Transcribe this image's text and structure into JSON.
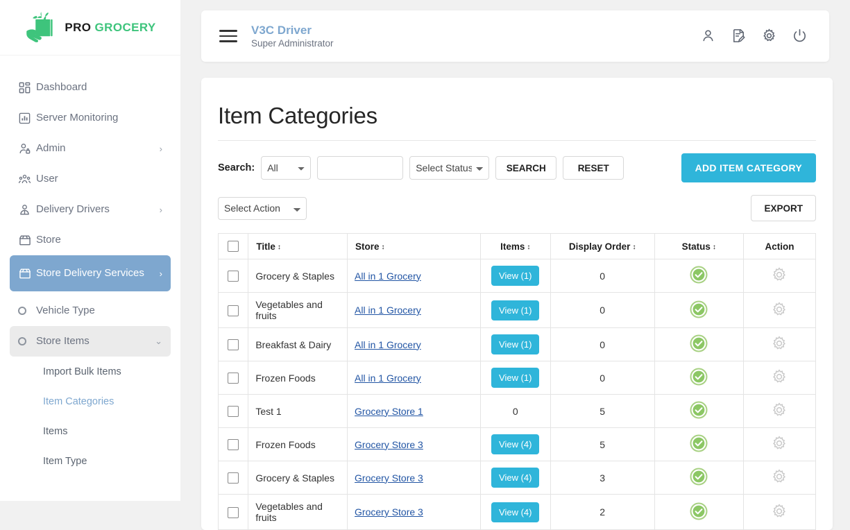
{
  "brand": {
    "pro": "PRO",
    "grocery": "GROCERY"
  },
  "sidebar": {
    "items": [
      {
        "label": "Dashboard",
        "icon": "dashboard-grid-icon",
        "chevron": ""
      },
      {
        "label": "Server Monitoring",
        "icon": "bar-chart-icon",
        "chevron": ""
      },
      {
        "label": "Admin",
        "icon": "admin-user-lock-icon",
        "chevron": "›"
      },
      {
        "label": "User",
        "icon": "users-group-icon",
        "chevron": ""
      },
      {
        "label": "Delivery Drivers",
        "icon": "driver-person-icon",
        "chevron": "›"
      },
      {
        "label": "Store",
        "icon": "store-icon",
        "chevron": ""
      },
      {
        "label": "Store Delivery Services",
        "icon": "store-icon",
        "chevron": "›"
      },
      {
        "label": "Vehicle Type",
        "icon": "circle-bullet-icon",
        "chevron": ""
      },
      {
        "label": "Store Items",
        "icon": "circle-bullet-icon",
        "chevron": "⌄"
      }
    ],
    "sub_items": [
      {
        "label": "Import Bulk Items"
      },
      {
        "label": "Item Categories"
      },
      {
        "label": "Items"
      },
      {
        "label": "Item Type"
      }
    ]
  },
  "topbar": {
    "menu_icon": "hamburger-menu-icon",
    "user_name": "V3C Driver",
    "user_role": "Super Administrator",
    "icons": [
      "profile-icon",
      "edit-document-icon",
      "gear-icon",
      "power-icon"
    ]
  },
  "page": {
    "title": "Item Categories",
    "search_label": "Search:",
    "search_scope_value": "All",
    "search_scope_options": [
      "All"
    ],
    "search_text_value": "",
    "search_text_placeholder": "",
    "status_filter_value": "Select Status",
    "status_filter_options": [
      "Select Status"
    ],
    "search_button": "SEARCH",
    "reset_button": "RESET",
    "add_button": "ADD ITEM CATEGORY",
    "bulk_action_value": "Select Action",
    "bulk_action_options": [
      "Select Action"
    ],
    "export_button": "EXPORT"
  },
  "table": {
    "columns": [
      {
        "key": "checkbox",
        "label": "",
        "sortable": false
      },
      {
        "key": "title",
        "label": "Title",
        "sortable": true
      },
      {
        "key": "store",
        "label": "Store",
        "sortable": true
      },
      {
        "key": "items",
        "label": "Items",
        "sortable": true
      },
      {
        "key": "display_order",
        "label": "Display Order",
        "sortable": true
      },
      {
        "key": "status",
        "label": "Status",
        "sortable": true
      },
      {
        "key": "action",
        "label": "Action",
        "sortable": false
      }
    ],
    "sort_glyph": "↕",
    "rows": [
      {
        "title": "Grocery & Staples",
        "store": "All in 1 Grocery",
        "items_label": "View (1)",
        "items_is_button": true,
        "display_order": "0",
        "status": "active",
        "action": "gear-icon"
      },
      {
        "title": "Vegetables and fruits",
        "store": "All in 1 Grocery",
        "items_label": "View (1)",
        "items_is_button": true,
        "display_order": "0",
        "status": "active",
        "action": "gear-icon"
      },
      {
        "title": "Breakfast & Dairy",
        "store": "All in 1 Grocery",
        "items_label": "View (1)",
        "items_is_button": true,
        "display_order": "0",
        "status": "active",
        "action": "gear-icon"
      },
      {
        "title": "Frozen Foods",
        "store": "All in 1 Grocery",
        "items_label": "View (1)",
        "items_is_button": true,
        "display_order": "0",
        "status": "active",
        "action": "gear-icon"
      },
      {
        "title": "Test 1",
        "store": "Grocery Store 1",
        "items_label": "0",
        "items_is_button": false,
        "display_order": "5",
        "status": "active",
        "action": "gear-icon"
      },
      {
        "title": "Frozen Foods",
        "store": "Grocery Store 3",
        "items_label": "View (4)",
        "items_is_button": true,
        "display_order": "5",
        "status": "active",
        "action": "gear-icon"
      },
      {
        "title": "Grocery & Staples",
        "store": "Grocery Store 3",
        "items_label": "View (4)",
        "items_is_button": true,
        "display_order": "3",
        "status": "active",
        "action": "gear-icon"
      },
      {
        "title": "Vegetables and fruits",
        "store": "Grocery Store 3",
        "items_label": "View (4)",
        "items_is_button": true,
        "display_order": "2",
        "status": "active",
        "action": "gear-icon"
      }
    ]
  },
  "colors": {
    "accent_cyan": "#2fb5da",
    "brand_green": "#3ec47c",
    "active_blue": "#7ea7cf",
    "status_green": "#8cc765",
    "link_blue": "#2255a4",
    "page_bg": "#f1f1f1"
  }
}
